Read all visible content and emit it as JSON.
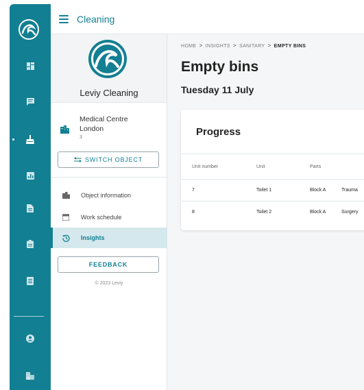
{
  "app": {
    "title": "Cleaning"
  },
  "rail": {
    "items": [
      {
        "icon": "dashboard-icon"
      },
      {
        "icon": "chat-icon"
      },
      {
        "icon": "cleaning-icon",
        "active": true
      },
      {
        "icon": "chart-icon"
      },
      {
        "icon": "document-icon"
      },
      {
        "icon": "clipboard-icon"
      },
      {
        "icon": "list-icon"
      },
      {
        "icon": "account-icon"
      },
      {
        "icon": "building-icon"
      }
    ]
  },
  "organization": {
    "name": "Leviy Cleaning"
  },
  "object": {
    "name": "Medical Centre",
    "city": "London",
    "number": "3"
  },
  "sidebar": {
    "switch_label": "SWITCH OBJECT",
    "nav": [
      {
        "label": "Object information",
        "icon": "building-icon"
      },
      {
        "label": "Work schedule",
        "icon": "calendar-icon"
      },
      {
        "label": "Insights",
        "icon": "history-icon",
        "active": true
      }
    ],
    "feedback_label": "FEEDBACK",
    "copyright": "© 2023 Leviy"
  },
  "breadcrumb": [
    "HOME",
    "INSIGHTS",
    "SANITARY",
    "EMPTY BINS"
  ],
  "page": {
    "title": "Empty bins",
    "date": "Tuesday 11 July"
  },
  "progress": {
    "title": "Progress",
    "columns": [
      "Unit number",
      "Unit",
      "Parts",
      ""
    ],
    "rows": [
      [
        "7",
        "Toilet 1",
        "Block A",
        "Trauma"
      ],
      [
        "8",
        "Toilet 2",
        "Block A",
        "Surgery"
      ]
    ]
  },
  "colors": {
    "brand": "#137f92",
    "active_bg": "#d4e8ed"
  }
}
